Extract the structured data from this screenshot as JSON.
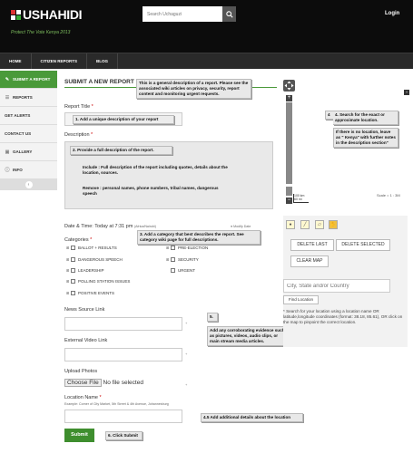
{
  "header": {
    "logo_text": "USHAHIDI",
    "tagline": "Protect The Vote Kenya 2013",
    "search_placeholder": "Search Uchaguzi",
    "login_label": "Login"
  },
  "nav": {
    "items": [
      "HOME",
      "CITIZEN REPORTS",
      "BLOG"
    ]
  },
  "sidebar": {
    "items": [
      {
        "label": "SUBMIT A REPORT",
        "icon": "pencil-icon"
      },
      {
        "label": "REPORTS",
        "icon": "list-icon"
      },
      {
        "label": "GET ALERTS",
        "icon": ""
      },
      {
        "label": "CONTACT US",
        "icon": ""
      },
      {
        "label": "GALLERY",
        "icon": "image-icon"
      },
      {
        "label": "INFO",
        "icon": "info-icon"
      }
    ]
  },
  "form": {
    "title": "SUBMIT A NEW REPORT",
    "report_title_label": "Report Title",
    "description_label": "Description",
    "datetime_label": "Date & Time: Today at 7:31 pm",
    "timezone": "(Africa/Nairobi)",
    "modify_date": "Modify Date",
    "categories_label": "Categories",
    "categories_left": [
      "BALLOT + RESULTS",
      "DANGEROUS SPEECH",
      "LEADERSHIP",
      "POLLING STATION ISSUES",
      "POSITIVE EVENTS"
    ],
    "categories_right": [
      "PRE-ELECTION",
      "SECURITY",
      "URGENT"
    ],
    "news_source_label": "News Source Link",
    "video_label": "External Video Link",
    "photos_label": "Upload Photos",
    "choose_file": "Choose File",
    "no_file": "No file selected",
    "location_name_label": "Location Name",
    "location_hint": "Example: Corner of City Market, 5th Street & 4th Avenue, Johannesburg",
    "submit_label": "Submit"
  },
  "annotations": {
    "intro": "This is a general description of a report. Please see the associated wiki articles on privacy, security, report content and monitoring urgent requests.",
    "n1": "1.    Add a unique description of your report",
    "n2": "2.    Provide a full description of the report.",
    "n2_include": "Include : Full description of the report including quotes, details about the location, sources.",
    "n2_remove": "Remove : personal names, phone numbers, tribal names, dangerous speech",
    "n3": "3. Add a category that best describes the report. See category wiki page for full descriptions.",
    "n4": "4.    Search for the exact or approximate location.",
    "n4_b": "If there is no location, leave as \" Kenya\" with further notes in the description section\"",
    "n5_num": "5.",
    "n5": "Add any corroborating evidence such as pictures, videos, audio clips, or main stream media articles.",
    "n45": "4.5 Add additional details about the location",
    "n6": "6. Click Submit"
  },
  "map": {
    "scale_label": "Scale = 1 : 3M",
    "scale_km": "100 km",
    "scale_mi": "60 mi"
  },
  "location": {
    "delete_last": "DELETE LAST",
    "delete_selected": "DELETE SELECTED",
    "clear_map": "CLEAR MAP",
    "input_placeholder": "City, State and/or Country",
    "find_label": "Find Location",
    "help": "* Search for your location using a location name OR latitude,longitude coordinates (format: 38.18, 85.61), OR click on the map to pinpoint the correct location."
  }
}
